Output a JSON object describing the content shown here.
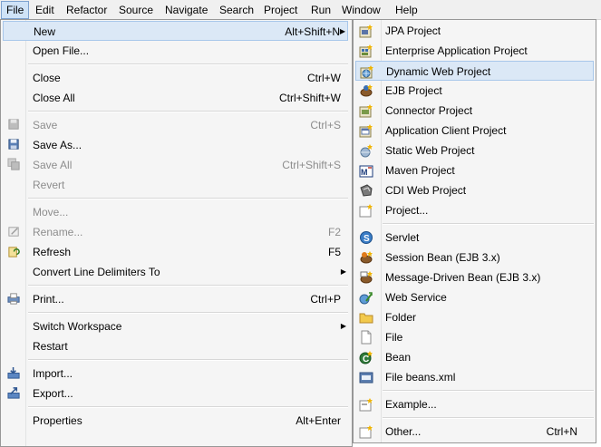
{
  "menubar": [
    "File",
    "Edit",
    "Refactor",
    "Source",
    "Navigate",
    "Search",
    "Project",
    "Run",
    "Window",
    "Help"
  ],
  "file_menu": [
    {
      "label": "New",
      "accel": "Alt+Shift+N",
      "submenu": true,
      "highlight": true,
      "icon": "none"
    },
    {
      "label": "Open File...",
      "icon": "none"
    },
    {
      "sep": true
    },
    {
      "label": "Close",
      "accel": "Ctrl+W",
      "icon": "none"
    },
    {
      "label": "Close All",
      "accel": "Ctrl+Shift+W",
      "icon": "none"
    },
    {
      "sep": true
    },
    {
      "label": "Save",
      "accel": "Ctrl+S",
      "disabled": true,
      "icon": "save-icon"
    },
    {
      "label": "Save As...",
      "icon": "save-as-icon"
    },
    {
      "label": "Save All",
      "accel": "Ctrl+Shift+S",
      "disabled": true,
      "icon": "save-all-icon"
    },
    {
      "label": "Revert",
      "disabled": true,
      "icon": "none"
    },
    {
      "sep": true
    },
    {
      "label": "Move...",
      "disabled": true,
      "icon": "none"
    },
    {
      "label": "Rename...",
      "accel": "F2",
      "disabled": true,
      "icon": "rename-icon"
    },
    {
      "label": "Refresh",
      "accel": "F5",
      "icon": "refresh-icon"
    },
    {
      "label": "Convert Line Delimiters To",
      "submenu": true,
      "icon": "none"
    },
    {
      "sep": true
    },
    {
      "label": "Print...",
      "accel": "Ctrl+P",
      "icon": "print-icon"
    },
    {
      "sep": true
    },
    {
      "label": "Switch Workspace",
      "submenu": true,
      "icon": "none"
    },
    {
      "label": "Restart",
      "icon": "none"
    },
    {
      "sep": true
    },
    {
      "label": "Import...",
      "icon": "import-icon"
    },
    {
      "label": "Export...",
      "icon": "export-icon"
    },
    {
      "sep": true
    },
    {
      "label": "Properties",
      "accel": "Alt+Enter",
      "icon": "none"
    }
  ],
  "new_submenu": [
    {
      "label": "JPA Project",
      "icon": "jpa-project-icon"
    },
    {
      "label": "Enterprise Application Project",
      "icon": "enterprise-project-icon"
    },
    {
      "label": "Dynamic Web Project",
      "highlight": true,
      "icon": "dynamic-web-project-icon"
    },
    {
      "label": "EJB Project",
      "icon": "ejb-project-icon"
    },
    {
      "label": "Connector Project",
      "icon": "connector-project-icon"
    },
    {
      "label": "Application Client Project",
      "icon": "app-client-project-icon"
    },
    {
      "label": "Static Web Project",
      "icon": "static-web-project-icon"
    },
    {
      "label": "Maven Project",
      "icon": "maven-project-icon"
    },
    {
      "label": "CDI Web Project",
      "icon": "cdi-web-project-icon"
    },
    {
      "label": "Project...",
      "icon": "project-icon"
    },
    {
      "sep": true
    },
    {
      "label": "Servlet",
      "icon": "servlet-icon"
    },
    {
      "label": "Session Bean (EJB 3.x)",
      "icon": "session-bean-icon"
    },
    {
      "label": "Message-Driven Bean (EJB 3.x)",
      "icon": "message-bean-icon"
    },
    {
      "label": "Web Service",
      "icon": "web-service-icon"
    },
    {
      "label": "Folder",
      "icon": "folder-icon"
    },
    {
      "label": "File",
      "icon": "file-icon"
    },
    {
      "label": "Bean",
      "icon": "bean-icon"
    },
    {
      "label": "File beans.xml",
      "icon": "beans-xml-icon"
    },
    {
      "sep": true
    },
    {
      "label": "Example...",
      "icon": "example-icon"
    },
    {
      "sep": true
    },
    {
      "label": "Other...",
      "accel": "Ctrl+N",
      "icon": "other-icon"
    }
  ]
}
